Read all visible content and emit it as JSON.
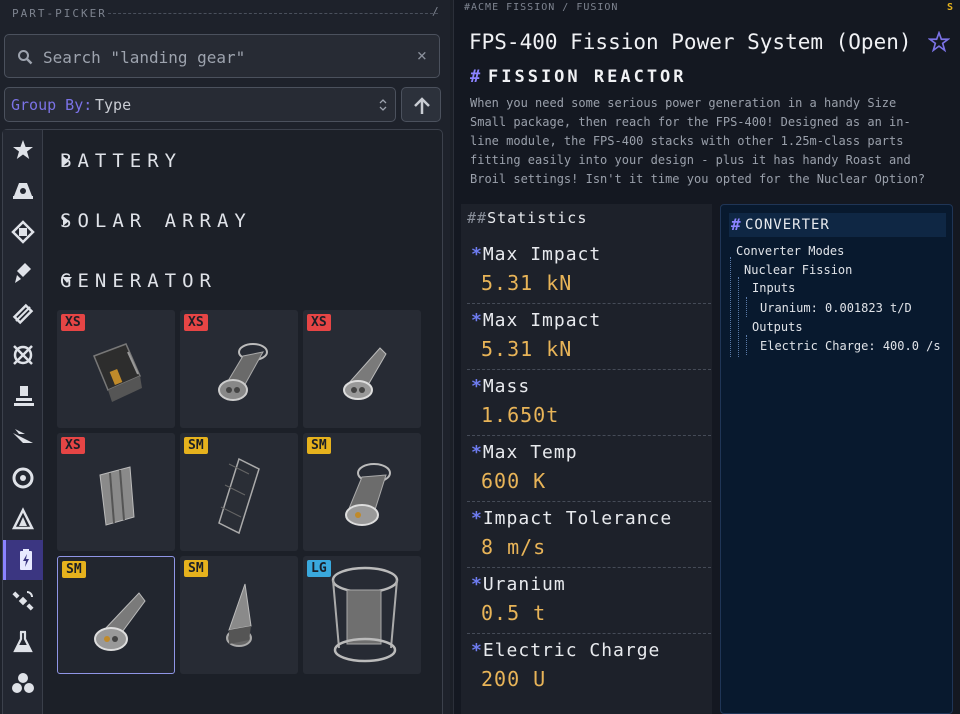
{
  "picker": {
    "title": "PART-PICKER",
    "search_value": "Search \"landing gear\"",
    "group_by_label": "Group By:",
    "group_by_value": "Type"
  },
  "categories": [
    {
      "name": "favorites-icon"
    },
    {
      "name": "command-pod-icon"
    },
    {
      "name": "fuel-tank-icon"
    },
    {
      "name": "engine-icon"
    },
    {
      "name": "structural-icon"
    },
    {
      "name": "coupling-icon"
    },
    {
      "name": "ground-icon"
    },
    {
      "name": "aero-icon"
    },
    {
      "name": "wheel-icon"
    },
    {
      "name": "payload-icon"
    },
    {
      "name": "power-icon"
    },
    {
      "name": "communication-icon"
    },
    {
      "name": "science-icon"
    },
    {
      "name": "cargo-icon"
    }
  ],
  "groups": [
    {
      "label": "BATTERY",
      "expanded": false
    },
    {
      "label": "SOLAR ARRAY",
      "expanded": false
    },
    {
      "label": "GENERATOR",
      "expanded": true
    }
  ],
  "parts": [
    {
      "size": "XS"
    },
    {
      "size": "XS"
    },
    {
      "size": "XS"
    },
    {
      "size": "XS"
    },
    {
      "size": "SM"
    },
    {
      "size": "SM"
    },
    {
      "size": "SM",
      "selected": true
    },
    {
      "size": "SM"
    },
    {
      "size": "LG"
    }
  ],
  "detail": {
    "breadcrumb": "#ACME FISSION / FUSION",
    "corner_badge": "S",
    "title": "FPS-400 Fission Power System (Open)",
    "section": "FISSION REACTOR",
    "description": "When you need some serious power generation in a handy Size\nSmall package, then reach for the FPS-400! Designed as an in-\nline module, the FPS-400 stacks with other 1.25m-class parts\nfitting easily into your design - plus it has handy Roast and\nBroil settings! Isn't it time you opted for the Nuclear Option?",
    "stats_header": "Statistics",
    "stats": [
      {
        "name": "Max Impact",
        "value": "5.31 kN"
      },
      {
        "name": "Max Impact",
        "value": "5.31 kN"
      },
      {
        "name": "Mass",
        "value": "1.650t"
      },
      {
        "name": "Max Temp",
        "value": "600 K"
      },
      {
        "name": "Impact Tolerance",
        "value": "8 m/s"
      },
      {
        "name": "Uranium",
        "value": "0.5 t"
      },
      {
        "name": "Electric Charge",
        "value": "200 U"
      }
    ],
    "converter": {
      "header": "CONVERTER",
      "modes_label": "Converter Modes",
      "mode": "Nuclear Fission",
      "inputs_label": "Inputs",
      "input": "Uranium: 0.001823 t/D",
      "outputs_label": "Outputs",
      "output": "Electric Charge: 400.0 /s"
    }
  },
  "colors": {
    "accent": "#8b83ff",
    "xs": "#e64545",
    "sm": "#e6b21d",
    "lg": "#3aa9dd",
    "value": "#e8b458"
  }
}
